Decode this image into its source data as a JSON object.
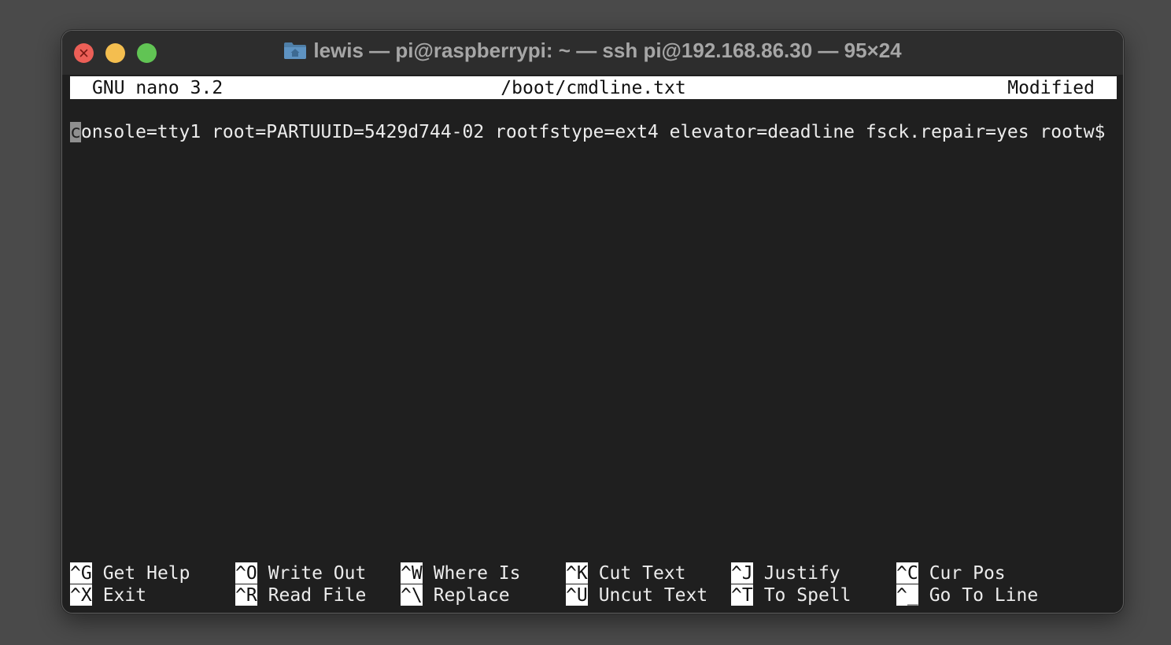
{
  "window": {
    "title": "lewis — pi@raspberrypi: ~ — ssh pi@192.168.86.30 — 95×24",
    "title_icon": "folder-home-icon",
    "controls": [
      "close",
      "minimize",
      "maximize"
    ]
  },
  "nano": {
    "version": "GNU nano 3.2",
    "filename": "/boot/cmdline.txt",
    "status": "Modified",
    "content_lines": [
      {
        "cursor_char": "c",
        "rest": "onsole=tty1 root=PARTUUID=5429d744-02 rootfstype=ext4 elevator=deadline fsck.repair=yes rootw$"
      }
    ],
    "shortcuts": [
      {
        "key": "^G",
        "label": "Get Help"
      },
      {
        "key": "^O",
        "label": "Write Out"
      },
      {
        "key": "^W",
        "label": "Where Is"
      },
      {
        "key": "^K",
        "label": "Cut Text"
      },
      {
        "key": "^J",
        "label": "Justify"
      },
      {
        "key": "^C",
        "label": "Cur Pos"
      },
      {
        "key": "^X",
        "label": "Exit"
      },
      {
        "key": "^R",
        "label": "Read File"
      },
      {
        "key": "^\\",
        "label": "Replace"
      },
      {
        "key": "^U",
        "label": "Uncut Text"
      },
      {
        "key": "^T",
        "label": "To Spell"
      },
      {
        "key": "^_",
        "label": "Go To Line"
      }
    ]
  },
  "colors": {
    "terminal_bg": "#1f1f1f",
    "terminal_fg": "#ececec",
    "inverse_bg": "#ffffff",
    "close": "#ec5f57",
    "minimize": "#f4be4f",
    "maximize": "#61c454"
  }
}
